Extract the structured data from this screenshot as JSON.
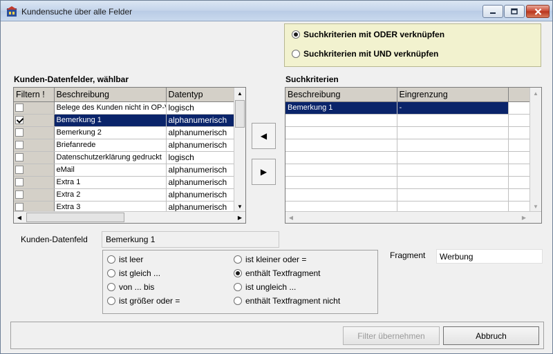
{
  "window": {
    "title": "Kundensuche über alle Felder",
    "buttons": {
      "minimize": "▁",
      "maximize": "▢",
      "close": "✕"
    }
  },
  "logic_options": [
    {
      "label": "Suchkriterien mit ODER verknüpfen",
      "selected": true
    },
    {
      "label": "Suchkriterien mit UND verknüpfen",
      "selected": false
    }
  ],
  "fields_panel": {
    "title": "Kunden-Datenfelder, wählbar",
    "columns": [
      "Filtern !",
      "Beschreibung",
      "Datentyp"
    ],
    "rows": [
      {
        "checked": false,
        "description": "Belege des Kunden nicht in OP-V",
        "type": "logisch",
        "selected": false
      },
      {
        "checked": true,
        "description": "Bemerkung 1",
        "type": "alphanumerisch",
        "selected": true
      },
      {
        "checked": false,
        "description": "Bemerkung 2",
        "type": "alphanumerisch",
        "selected": false
      },
      {
        "checked": false,
        "description": "Briefanrede",
        "type": "alphanumerisch",
        "selected": false
      },
      {
        "checked": false,
        "description": "Datenschutzerklärung gedruckt",
        "type": "logisch",
        "selected": false
      },
      {
        "checked": false,
        "description": "eMail",
        "type": "alphanumerisch",
        "selected": false
      },
      {
        "checked": false,
        "description": "Extra 1",
        "type": "alphanumerisch",
        "selected": false
      },
      {
        "checked": false,
        "description": "Extra 2",
        "type": "alphanumerisch",
        "selected": false
      },
      {
        "checked": false,
        "description": "Extra 3",
        "type": "alphanumerisch",
        "selected": false
      }
    ]
  },
  "criteria_panel": {
    "title": "Suchkriterien",
    "columns": [
      "Beschreibung",
      "Eingrenzung"
    ],
    "rows": [
      {
        "description": "Bemerkung 1",
        "restriction": "-",
        "selected": true
      }
    ]
  },
  "move_buttons": {
    "remove": "◀",
    "add": "▶"
  },
  "selected_field": {
    "label": "Kunden-Datenfeld",
    "value": "Bemerkung 1"
  },
  "operators": {
    "left": [
      {
        "label": "ist leer",
        "selected": false
      },
      {
        "label": "ist gleich ...",
        "selected": false
      },
      {
        "label": "von ... bis",
        "selected": false
      },
      {
        "label": "ist größer oder =",
        "selected": false
      }
    ],
    "right": [
      {
        "label": "ist kleiner oder =",
        "selected": false
      },
      {
        "label": "enthält Textfragment",
        "selected": true
      },
      {
        "label": "ist ungleich ...",
        "selected": false
      },
      {
        "label": "enthält Textfragment nicht",
        "selected": false
      }
    ]
  },
  "fragment": {
    "label": "Fragment",
    "value": "Werbung"
  },
  "footer": {
    "apply": "Filter übernehmen",
    "cancel": "Abbruch"
  },
  "colors": {
    "selection": "#0a246a",
    "radio_panel": "#f2f2cf",
    "header": "#d4d0c8"
  }
}
